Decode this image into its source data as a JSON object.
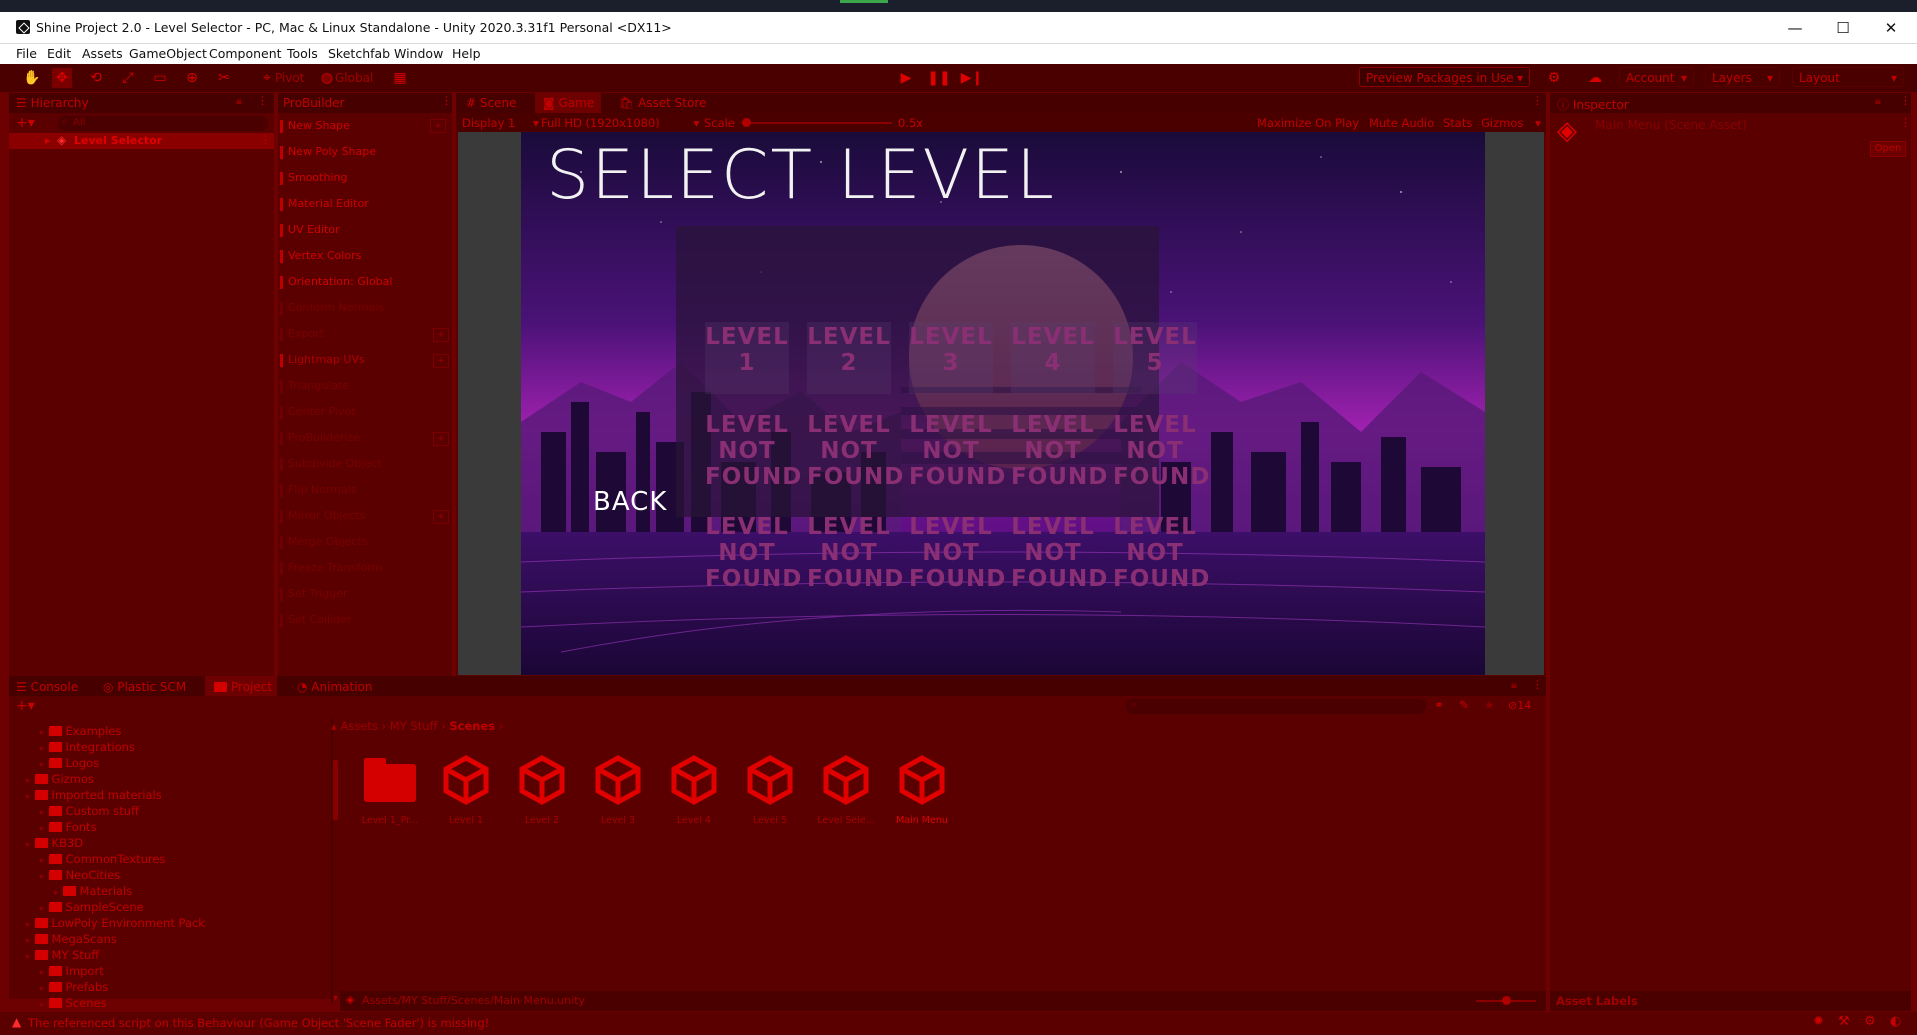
{
  "window": {
    "title": "Shine Project 2.0 - Level Selector - PC, Mac & Linux Standalone - Unity 2020.3.31f1 Personal <DX11>",
    "minimize": "—",
    "maximize": "☐",
    "close": "✕"
  },
  "menu": [
    "File",
    "Edit",
    "Assets",
    "GameObject",
    "Component",
    "Tools",
    "Sketchfab",
    "Window",
    "Help"
  ],
  "toolbar": {
    "pivot": "Pivot",
    "global": "Global",
    "preview_packages": "Preview Packages in Use",
    "account": "Account",
    "layers": "Layers",
    "layout": "Layout"
  },
  "hierarchy": {
    "tab": "Hierarchy",
    "search_placeholder": "All",
    "items": [
      "Level Selector"
    ]
  },
  "probuilder": {
    "tab": "ProBuilder",
    "items": [
      "New Shape",
      "New Poly Shape",
      "Smoothing",
      "Material Editor",
      "UV Editor",
      "Vertex Colors",
      "Orientation: Global",
      "Conform Normals",
      "Export",
      "Lightmap UVs",
      "Triangulate",
      "Center Pivot",
      "ProBuilderize",
      "Subdivide Object",
      "Flip Normals",
      "Mirror Objects",
      "Merge Objects",
      "Freeze Transform",
      "Set Trigger",
      "Set Collider"
    ]
  },
  "game_tabs": {
    "scene": "Scene",
    "game": "Game",
    "asset_store": "Asset Store"
  },
  "game_toolbar": {
    "display": "Display 1",
    "resolution": "Full HD (1920x1080)",
    "scale_label": "Scale",
    "scale_value": "0.5x",
    "maximize": "Maximize On Play",
    "mute": "Mute Audio",
    "stats": "Stats",
    "gizmos": "Gizmos"
  },
  "game": {
    "title": "SELECT LEVEL",
    "back": "BACK",
    "row1": [
      {
        "l1": "LEVEL",
        "l2": "1"
      },
      {
        "l1": "LEVEL",
        "l2": "2"
      },
      {
        "l1": "LEVEL",
        "l2": "3"
      },
      {
        "l1": "LEVEL",
        "l2": "4"
      },
      {
        "l1": "LEVEL",
        "l2": "5"
      }
    ],
    "not_found": {
      "l1": "LEVEL",
      "l2": "NOT",
      "l3": "FOUND"
    }
  },
  "inspector": {
    "tab": "Inspector",
    "asset": "Main Menu (Scene Asset)",
    "open": "Open",
    "asset_labels": "Asset Labels"
  },
  "bottom_tabs": {
    "console": "Console",
    "plastic": "Plastic SCM",
    "project": "Project",
    "animation": "Animation",
    "hidden_count": "14"
  },
  "project_tree": [
    {
      "label": "Examples",
      "indent": 2
    },
    {
      "label": "Integrations",
      "indent": 2
    },
    {
      "label": "Logos",
      "indent": 2
    },
    {
      "label": "Gizmos",
      "indent": 1
    },
    {
      "label": "Imported materials",
      "indent": 1
    },
    {
      "label": "Custom stuff",
      "indent": 2
    },
    {
      "label": "Fonts",
      "indent": 2
    },
    {
      "label": "KB3D",
      "indent": 1
    },
    {
      "label": "CommonTextures",
      "indent": 2
    },
    {
      "label": "NeoCities",
      "indent": 2
    },
    {
      "label": "Materials",
      "indent": 3
    },
    {
      "label": "SampleScene",
      "indent": 2
    },
    {
      "label": "LowPoly Environment Pack",
      "indent": 1
    },
    {
      "label": "MegaScans",
      "indent": 1
    },
    {
      "label": "MY Stuff",
      "indent": 1
    },
    {
      "label": "Import",
      "indent": 2
    },
    {
      "label": "Prefabs",
      "indent": 2
    },
    {
      "label": "Scenes",
      "indent": 2
    }
  ],
  "breadcrumb": [
    "Assets",
    "MY Stuff",
    "Scenes"
  ],
  "assets": [
    {
      "label": "Level 1_Pr...",
      "type": "folder"
    },
    {
      "label": "Level 1",
      "type": "scene"
    },
    {
      "label": "Level 2",
      "type": "scene"
    },
    {
      "label": "Level 3",
      "type": "scene"
    },
    {
      "label": "Level 4",
      "type": "scene"
    },
    {
      "label": "Level 5",
      "type": "scene"
    },
    {
      "label": "Level Sele...",
      "type": "scene"
    },
    {
      "label": "Main Menu",
      "type": "scene"
    }
  ],
  "asset_path": "Assets/MY Stuff/Scenes/Main Menu.unity",
  "status": "The referenced script on this Behaviour (Game Object 'Scene Fader') is missing!"
}
